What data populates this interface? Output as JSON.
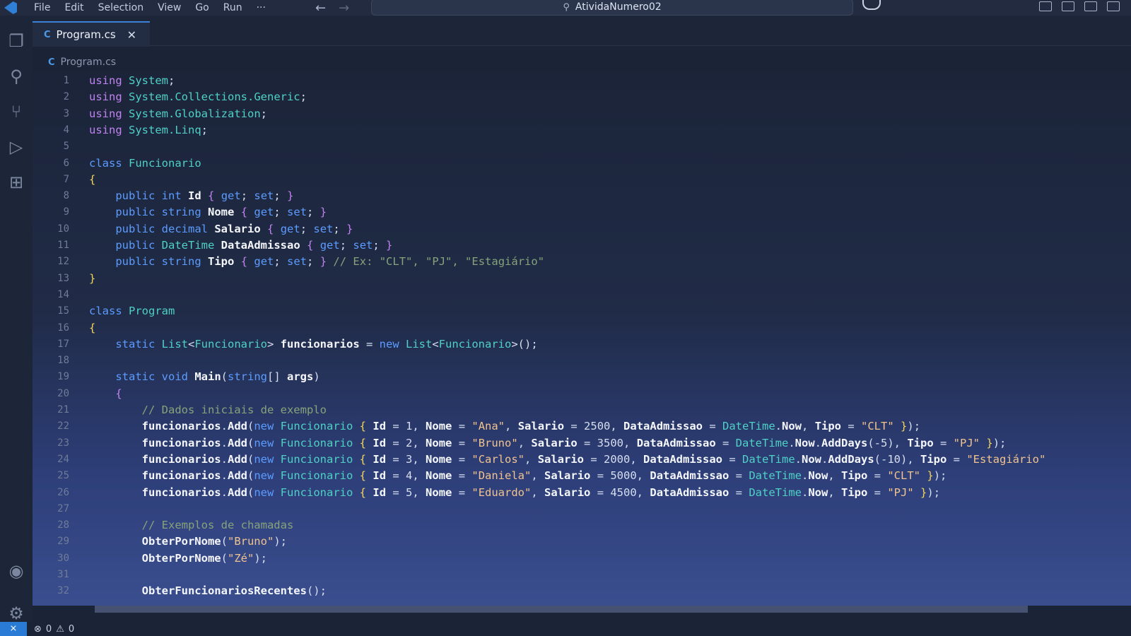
{
  "titlebar": {
    "menu": [
      "File",
      "Edit",
      "Selection",
      "View",
      "Go",
      "Run",
      "···"
    ],
    "title": "AtividaNumero02"
  },
  "tab": {
    "label": "Program.cs"
  },
  "breadcrumb": {
    "file": "Program.cs"
  },
  "code": {
    "lines": [
      {
        "n": "1",
        "html": "<span class=\"kw\">using</span> <span class=\"ty\">System</span>;"
      },
      {
        "n": "2",
        "html": "<span class=\"kw\">using</span> <span class=\"ty\">System.Collections.Generic</span>;"
      },
      {
        "n": "3",
        "html": "<span class=\"kw\">using</span> <span class=\"ty\">System.Globalization</span>;"
      },
      {
        "n": "4",
        "html": "<span class=\"kw\">using</span> <span class=\"ty\">System.Linq</span>;"
      },
      {
        "n": "5",
        "html": ""
      },
      {
        "n": "6",
        "html": "<span class=\"kw2\">class</span> <span class=\"ty\">Funcionario</span>"
      },
      {
        "n": "7",
        "html": "<span class=\"br\">{</span>"
      },
      {
        "n": "8",
        "html": "    <span class=\"kw2\">public</span> <span class=\"kw2\">int</span> <span class=\"id\">Id</span> <span class=\"kw\">{</span> <span class=\"kw2\">get</span>; <span class=\"kw2\">set</span>; <span class=\"kw\">}</span>"
      },
      {
        "n": "9",
        "html": "    <span class=\"kw2\">public</span> <span class=\"kw2\">string</span> <span class=\"id\">Nome</span> <span class=\"kw\">{</span> <span class=\"kw2\">get</span>; <span class=\"kw2\">set</span>; <span class=\"kw\">}</span>"
      },
      {
        "n": "10",
        "html": "    <span class=\"kw2\">public</span> <span class=\"kw2\">decimal</span> <span class=\"id\">Salario</span> <span class=\"kw\">{</span> <span class=\"kw2\">get</span>; <span class=\"kw2\">set</span>; <span class=\"kw\">}</span>"
      },
      {
        "n": "11",
        "html": "    <span class=\"kw2\">public</span> <span class=\"ty\">DateTime</span> <span class=\"id\">DataAdmissao</span> <span class=\"kw\">{</span> <span class=\"kw2\">get</span>; <span class=\"kw2\">set</span>; <span class=\"kw\">}</span>"
      },
      {
        "n": "12",
        "html": "    <span class=\"kw2\">public</span> <span class=\"kw2\">string</span> <span class=\"id\">Tipo</span> <span class=\"kw\">{</span> <span class=\"kw2\">get</span>; <span class=\"kw2\">set</span>; <span class=\"kw\">}</span> <span class=\"cm\">// Ex: \"CLT\", \"PJ\", \"Estagiário\"</span>"
      },
      {
        "n": "13",
        "html": "<span class=\"br\">}</span>"
      },
      {
        "n": "14",
        "html": ""
      },
      {
        "n": "15",
        "html": "<span class=\"kw2\">class</span> <span class=\"ty\">Program</span>"
      },
      {
        "n": "16",
        "html": "<span class=\"br\">{</span>"
      },
      {
        "n": "17",
        "html": "    <span class=\"kw2\">static</span> <span class=\"ty\">List</span>&lt;<span class=\"ty\">Funcionario</span>&gt; <span class=\"id\">funcionarios</span> = <span class=\"kw2\">new</span> <span class=\"ty\">List</span>&lt;<span class=\"ty\">Funcionario</span>&gt;();"
      },
      {
        "n": "18",
        "html": ""
      },
      {
        "n": "19",
        "html": "    <span class=\"kw2\">static</span> <span class=\"kw2\">void</span> <span class=\"id\">Main</span>(<span class=\"kw2\">string</span>[] <span class=\"id\">args</span>)"
      },
      {
        "n": "20",
        "html": "    <span class=\"kw\">{</span>"
      },
      {
        "n": "21",
        "html": "        <span class=\"cm\">// Dados iniciais de exemplo</span>"
      },
      {
        "n": "22",
        "html": "        <span class=\"id\">funcionarios</span>.<span class=\"id\">Add</span>(<span class=\"kw2\">new</span> <span class=\"ty\">Funcionario</span> <span class=\"br\">{</span> <span class=\"id\">Id</span> = 1, <span class=\"id\">Nome</span> = <span class=\"str\">\"Ana\"</span>, <span class=\"id\">Salario</span> = 2500, <span class=\"id\">DataAdmissao</span> = <span class=\"ty\">DateTime</span>.<span class=\"id\">Now</span>, <span class=\"id\">Tipo</span> = <span class=\"str\">\"CLT\"</span> <span class=\"br\">}</span>);"
      },
      {
        "n": "23",
        "html": "        <span class=\"id\">funcionarios</span>.<span class=\"id\">Add</span>(<span class=\"kw2\">new</span> <span class=\"ty\">Funcionario</span> <span class=\"br\">{</span> <span class=\"id\">Id</span> = 2, <span class=\"id\">Nome</span> = <span class=\"str\">\"Bruno\"</span>, <span class=\"id\">Salario</span> = 3500, <span class=\"id\">DataAdmissao</span> = <span class=\"ty\">DateTime</span>.<span class=\"id\">Now</span>.<span class=\"id\">AddDays</span>(-5), <span class=\"id\">Tipo</span> = <span class=\"str\">\"PJ\"</span> <span class=\"br\">}</span>);"
      },
      {
        "n": "24",
        "html": "        <span class=\"id\">funcionarios</span>.<span class=\"id\">Add</span>(<span class=\"kw2\">new</span> <span class=\"ty\">Funcionario</span> <span class=\"br\">{</span> <span class=\"id\">Id</span> = 3, <span class=\"id\">Nome</span> = <span class=\"str\">\"Carlos\"</span>, <span class=\"id\">Salario</span> = 2000, <span class=\"id\">DataAdmissao</span> = <span class=\"ty\">DateTime</span>.<span class=\"id\">Now</span>.<span class=\"id\">AddDays</span>(-10), <span class=\"id\">Tipo</span> = <span class=\"str\">\"Estagiário\"</span>"
      },
      {
        "n": "25",
        "html": "        <span class=\"id\">funcionarios</span>.<span class=\"id\">Add</span>(<span class=\"kw2\">new</span> <span class=\"ty\">Funcionario</span> <span class=\"br\">{</span> <span class=\"id\">Id</span> = 4, <span class=\"id\">Nome</span> = <span class=\"str\">\"Daniela\"</span>, <span class=\"id\">Salario</span> = 5000, <span class=\"id\">DataAdmissao</span> = <span class=\"ty\">DateTime</span>.<span class=\"id\">Now</span>, <span class=\"id\">Tipo</span> = <span class=\"str\">\"CLT\"</span> <span class=\"br\">}</span>);"
      },
      {
        "n": "26",
        "html": "        <span class=\"id\">funcionarios</span>.<span class=\"id\">Add</span>(<span class=\"kw2\">new</span> <span class=\"ty\">Funcionario</span> <span class=\"br\">{</span> <span class=\"id\">Id</span> = 5, <span class=\"id\">Nome</span> = <span class=\"str\">\"Eduardo\"</span>, <span class=\"id\">Salario</span> = 4500, <span class=\"id\">DataAdmissao</span> = <span class=\"ty\">DateTime</span>.<span class=\"id\">Now</span>, <span class=\"id\">Tipo</span> = <span class=\"str\">\"PJ\"</span> <span class=\"br\">}</span>);"
      },
      {
        "n": "27",
        "html": ""
      },
      {
        "n": "28",
        "html": "        <span class=\"cm\">// Exemplos de chamadas</span>"
      },
      {
        "n": "29",
        "html": "        <span class=\"id\">ObterPorNome</span>(<span class=\"str\">\"Bruno\"</span>);"
      },
      {
        "n": "30",
        "html": "        <span class=\"id\">ObterPorNome</span>(<span class=\"str\">\"Zé\"</span>);"
      },
      {
        "n": "31",
        "html": ""
      },
      {
        "n": "32",
        "html": "        <span class=\"id\">ObterFuncionariosRecentes</span>();"
      }
    ]
  },
  "status": {
    "errors": "0",
    "warnings": "0"
  }
}
